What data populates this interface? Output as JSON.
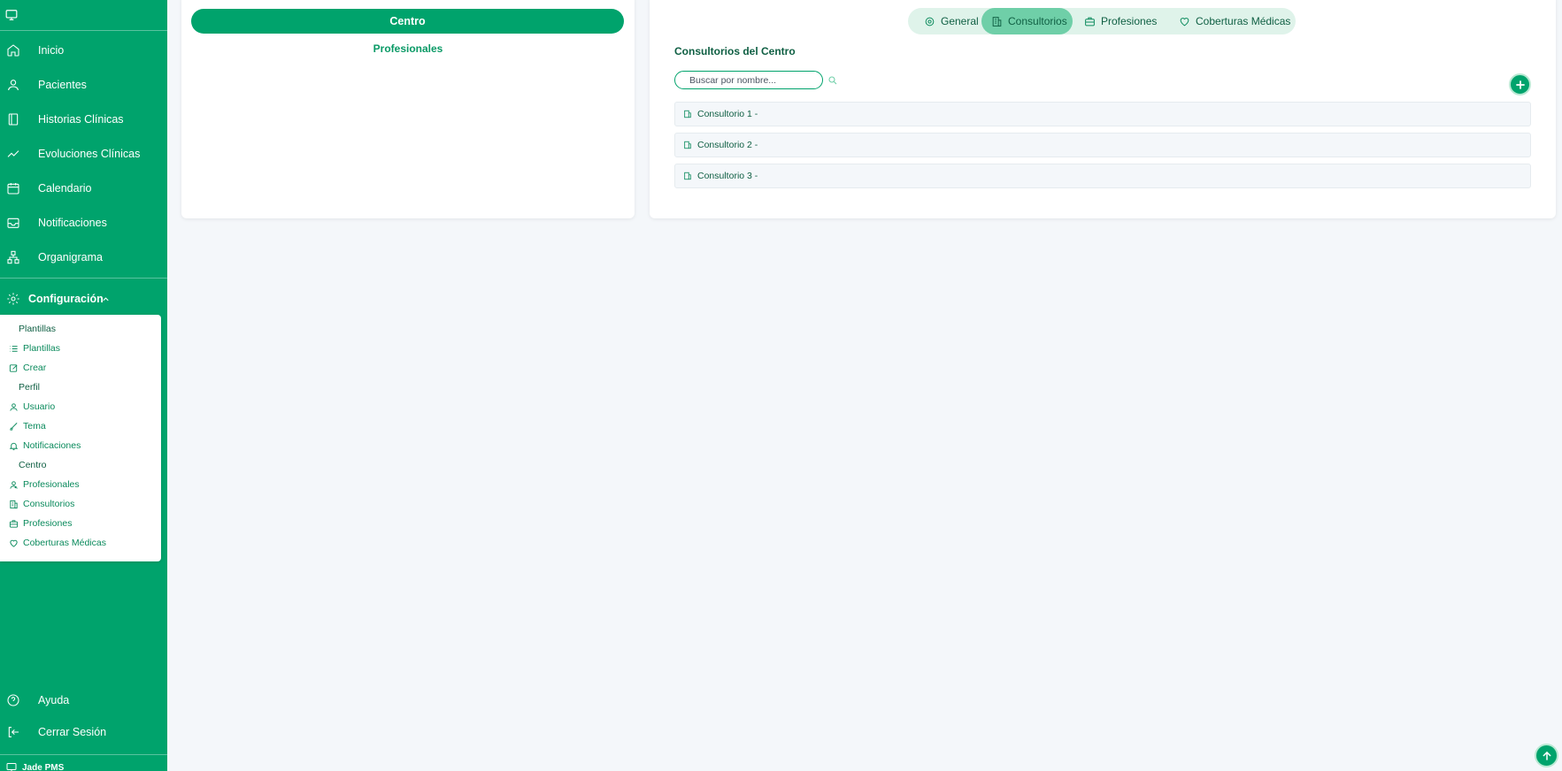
{
  "sidebar": {
    "nav": [
      {
        "label": "Inicio",
        "icon": "home-icon"
      },
      {
        "label": "Pacientes",
        "icon": "user-icon"
      },
      {
        "label": "Historias Clínicas",
        "icon": "book-icon"
      },
      {
        "label": "Evoluciones Clínicas",
        "icon": "trend-icon"
      },
      {
        "label": "Calendario",
        "icon": "calendar-icon"
      },
      {
        "label": "Notificaciones",
        "icon": "inbox-icon"
      },
      {
        "label": "Organigrama",
        "icon": "org-icon"
      }
    ],
    "config_label": "Configuración",
    "submenu": {
      "group_plantillas": "Plantillas",
      "plantillas": "Plantillas",
      "crear": "Crear",
      "group_perfil": "Perfil",
      "usuario": "Usuario",
      "tema": "Tema",
      "notificaciones": "Notificaciones",
      "group_centro": "Centro",
      "profesionales": "Profesionales",
      "consultorios": "Consultorios",
      "profesiones": "Profesiones",
      "coberturas": "Coberturas Médicas"
    },
    "ayuda": "Ayuda",
    "logout": "Cerrar Sesión",
    "brand": "Jade PMS"
  },
  "left_card": {
    "centro_button": "Centro",
    "profesionales_link": "Profesionales"
  },
  "right_card": {
    "tabs": [
      "General",
      "Consultorios",
      "Profesiones",
      "Coberturas Médicas"
    ],
    "active_tab": "Consultorios",
    "section_title": "Consultorios del Centro",
    "search_placeholder": "Buscar por nombre...",
    "items": [
      "Consultorio 1 -",
      "Consultorio 2 -",
      "Consultorio 3 -"
    ]
  },
  "colors": {
    "brand_green": "#00a36c",
    "tab_bg": "#dff3ea",
    "tab_active": "#6fcfa8",
    "page_bg": "#f4f7fa"
  }
}
